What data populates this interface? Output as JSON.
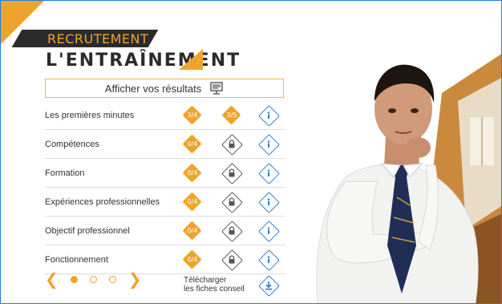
{
  "header": {
    "kicker": "RECRUTEMENT",
    "title": "L'ENTRAÎNEMENT"
  },
  "results_button": {
    "label": "Afficher vos résultats",
    "icon": "presentation-board-icon"
  },
  "modules": [
    {
      "label": "Les premières minutes",
      "score1": "3/4",
      "score2": "3/5",
      "locked": false
    },
    {
      "label": "Compétences",
      "score1": "0/4",
      "score2": "",
      "locked": true
    },
    {
      "label": "Formation",
      "score1": "0/4",
      "score2": "",
      "locked": true
    },
    {
      "label": "Expériences professionnelles",
      "score1": "0/4",
      "score2": "",
      "locked": true
    },
    {
      "label": "Objectif professionnel",
      "score1": "0/4",
      "score2": "",
      "locked": true
    },
    {
      "label": "Fonctionnement",
      "score1": "0/4",
      "score2": "",
      "locked": true
    }
  ],
  "pager": {
    "prev_icon": "chevron-left-icon",
    "next_icon": "chevron-right-icon",
    "pages": 3,
    "current_page": 1
  },
  "download": {
    "line1": "Télécharger",
    "line2": "les fiches conseil",
    "icon": "download-icon"
  },
  "colors": {
    "accent": "#f0a32c",
    "dark": "#2b2b2b",
    "info_blue": "#2a7bd6",
    "lock_grey": "#555555"
  }
}
